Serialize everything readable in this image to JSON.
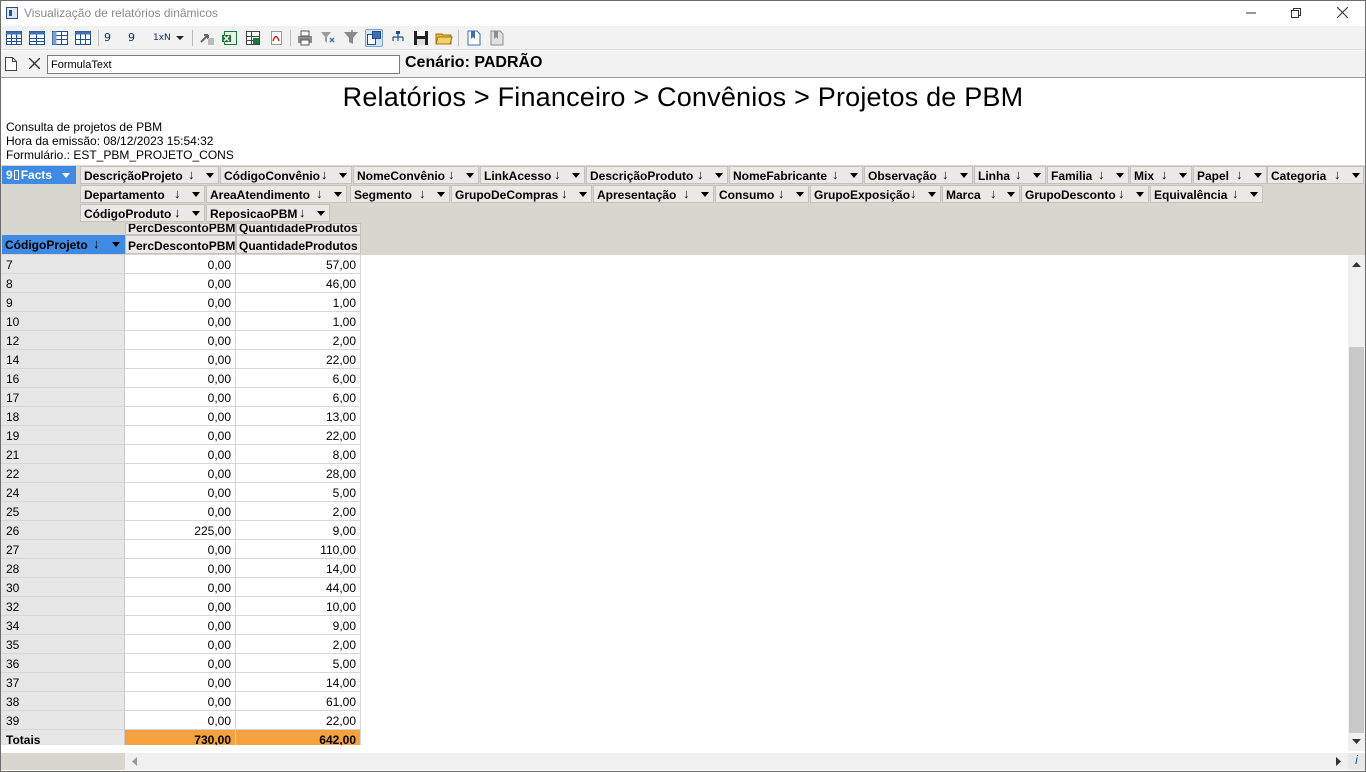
{
  "window": {
    "title": "Visualização de relatórios dinâmicos",
    "controls": [
      "minimize-icon",
      "restore-icon",
      "close-icon"
    ]
  },
  "toolbar": {
    "items": [
      "grid-icon",
      "table-icon",
      "pivot-icon",
      "calc-grid-icon",
      "sort-9-0-icon",
      "sort-9-0-alt-icon",
      "1xn-icon",
      "arrow-right-icon",
      "export-excel-icon",
      "export-grid-icon",
      "export-pdf-icon",
      "print-icon",
      "filter-icon",
      "funnel-icon",
      "layout-icon",
      "hierarchy-icon",
      "save-icon",
      "open-folder-icon",
      "bookmark-icon",
      "bookmark-gray-icon"
    ],
    "labels": {
      "sort1": "9",
      "sort2": "9",
      "onexn": "1xN"
    }
  },
  "formulabar": {
    "value": "FormulaText",
    "cenario": "Cenário: PADRÃO"
  },
  "report": {
    "title": "Relatórios > Financeiro > Convênios > Projetos de PBM",
    "info": [
      "Consulta de projetos de PBM",
      "Hora da emissão: 08/12/2023 15:54:32",
      "Formulário.: EST_PBM_PROJETO_CONS"
    ]
  },
  "facts": {
    "label": "Facts",
    "prefix": "9"
  },
  "fields_row1": [
    "DescriçãoProjeto",
    "CódigoConvênio",
    "NomeConvênio",
    "LinkAcesso",
    "DescriçãoProduto",
    "NomeFabricante",
    "Observação",
    "Linha",
    "Familia",
    "Mix",
    "Papel",
    "Categoria"
  ],
  "fields_row2": [
    "Departamento",
    "AreaAtendimento",
    "Segmento",
    "GrupoDeCompras",
    "Apresentação",
    "Consumo",
    "GrupoExposição",
    "Marca",
    "GrupoDesconto",
    "Equivalência"
  ],
  "fields_row3": [
    "CódigoProduto",
    "ReposicaoPBM"
  ],
  "grid": {
    "row_field": "CódigoProjeto",
    "measure_headers_top": [
      "PercDescontoPBM",
      "QuantidadeProdutos"
    ],
    "measure_headers": [
      "PercDescontoPBM",
      "QuantidadeProdutos"
    ],
    "rows": [
      {
        "id": "7",
        "perc": "0,00",
        "qtd": "57,00"
      },
      {
        "id": "8",
        "perc": "0,00",
        "qtd": "46,00"
      },
      {
        "id": "9",
        "perc": "0,00",
        "qtd": "1,00"
      },
      {
        "id": "10",
        "perc": "0,00",
        "qtd": "1,00"
      },
      {
        "id": "12",
        "perc": "0,00",
        "qtd": "2,00"
      },
      {
        "id": "14",
        "perc": "0,00",
        "qtd": "22,00"
      },
      {
        "id": "16",
        "perc": "0,00",
        "qtd": "6,00"
      },
      {
        "id": "17",
        "perc": "0,00",
        "qtd": "6,00"
      },
      {
        "id": "18",
        "perc": "0,00",
        "qtd": "13,00"
      },
      {
        "id": "19",
        "perc": "0,00",
        "qtd": "22,00"
      },
      {
        "id": "21",
        "perc": "0,00",
        "qtd": "8,00"
      },
      {
        "id": "22",
        "perc": "0,00",
        "qtd": "28,00"
      },
      {
        "id": "24",
        "perc": "0,00",
        "qtd": "5,00"
      },
      {
        "id": "25",
        "perc": "0,00",
        "qtd": "2,00"
      },
      {
        "id": "26",
        "perc": "225,00",
        "qtd": "9,00"
      },
      {
        "id": "27",
        "perc": "0,00",
        "qtd": "110,00"
      },
      {
        "id": "28",
        "perc": "0,00",
        "qtd": "14,00"
      },
      {
        "id": "30",
        "perc": "0,00",
        "qtd": "44,00"
      },
      {
        "id": "32",
        "perc": "0,00",
        "qtd": "10,00"
      },
      {
        "id": "34",
        "perc": "0,00",
        "qtd": "9,00"
      },
      {
        "id": "35",
        "perc": "0,00",
        "qtd": "2,00"
      },
      {
        "id": "36",
        "perc": "0,00",
        "qtd": "5,00"
      },
      {
        "id": "37",
        "perc": "0,00",
        "qtd": "14,00"
      },
      {
        "id": "38",
        "perc": "0,00",
        "qtd": "61,00"
      },
      {
        "id": "39",
        "perc": "0,00",
        "qtd": "22,00"
      }
    ],
    "totals": {
      "label": "Totais",
      "perc": "730,00",
      "qtd": "642,00"
    }
  },
  "status": {
    "corner": "i"
  },
  "colors": {
    "accent": "#3f8be3",
    "totals": "#f4a23f",
    "field_area": "#d9d6d0"
  }
}
